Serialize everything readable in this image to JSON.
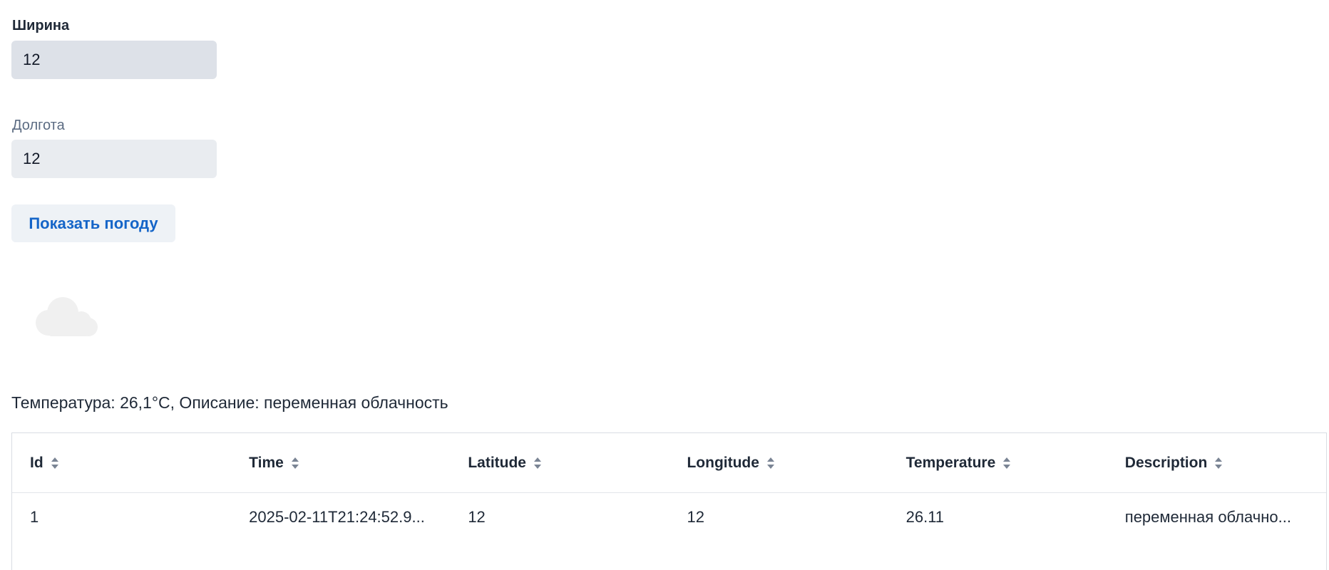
{
  "form": {
    "latitude_label": "Ширина",
    "latitude_value": "12",
    "longitude_label": "Долгота",
    "longitude_value": "12",
    "submit_label": "Показать погоду"
  },
  "weather": {
    "icon": "cloud-icon",
    "summary": "Температура: 26,1°C, Описание: переменная облачность"
  },
  "table": {
    "columns": [
      "Id",
      "Time",
      "Latitude",
      "Longitude",
      "Temperature",
      "Description"
    ],
    "sort_icon": "sort-icon",
    "rows": [
      [
        "1",
        "2025-02-11T21:24:52.9...",
        "12",
        "12",
        "26.11",
        "переменная облачно..."
      ]
    ]
  },
  "colors": {
    "accent": "#1565c8",
    "input_focused": "#dde1e8",
    "input_normal": "#e9ecf0",
    "cloud": "#f0f0f0"
  }
}
